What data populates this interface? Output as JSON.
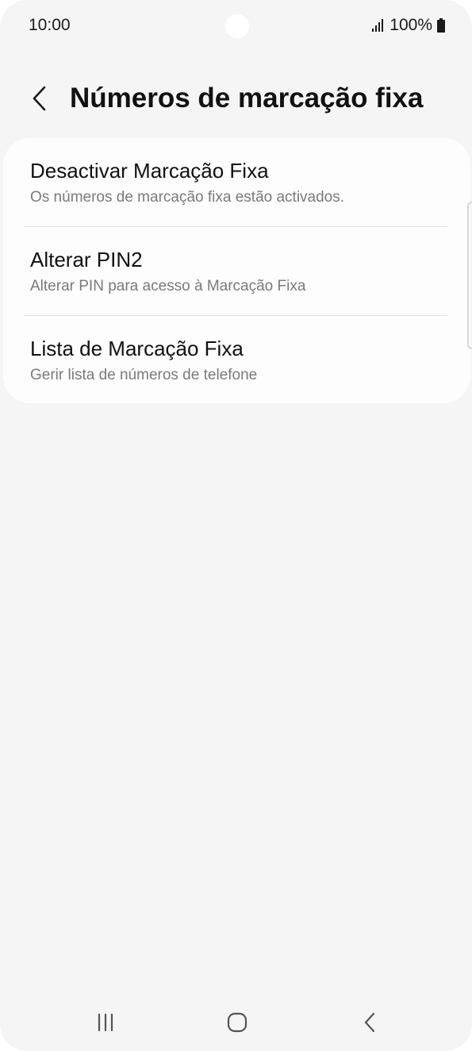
{
  "status_bar": {
    "time": "10:00",
    "battery": "100%",
    "icons": [
      "signal-icon",
      "battery-icon"
    ]
  },
  "header": {
    "title": "Números de marcação fixa",
    "back_icon": "chevron-left-icon"
  },
  "settings": {
    "items": [
      {
        "title": "Desactivar Marcação Fixa",
        "subtitle": "Os números de marcação fixa estão activados."
      },
      {
        "title": "Alterar PIN2",
        "subtitle": "Alterar PIN para acesso à Marcação Fixa"
      },
      {
        "title": "Lista de Marcação Fixa",
        "subtitle": "Gerir lista de números de telefone"
      }
    ]
  },
  "nav_bar": {
    "icons": [
      "recent-apps-icon",
      "home-icon",
      "back-icon"
    ]
  },
  "colors": {
    "background": "#f5f5f5",
    "card": "#fdfdfd",
    "title_text": "#111111",
    "subtitle_text": "#7a7a7a",
    "divider": "#e2e2e2"
  }
}
